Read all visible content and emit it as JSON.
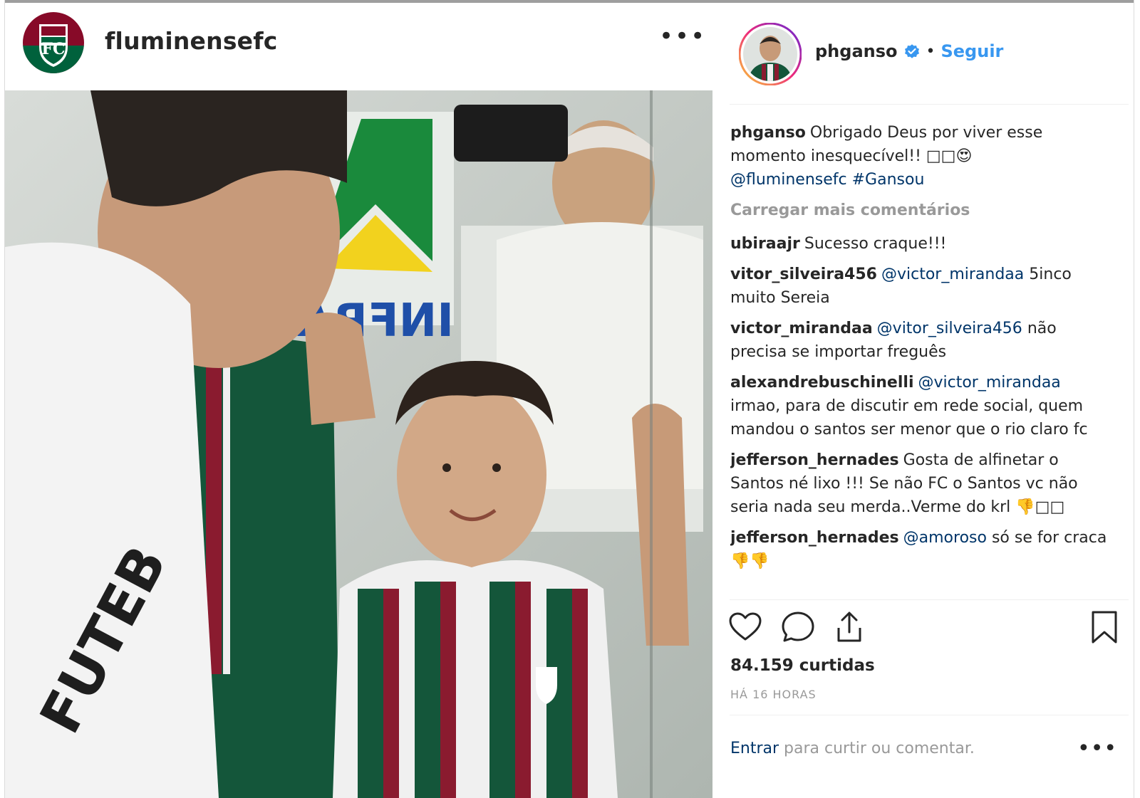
{
  "left_header": {
    "username": "fluminensefc",
    "more_label": "•••"
  },
  "post": {
    "author": "phganso",
    "follow_label": "Seguir",
    "separator": "•",
    "caption": {
      "user": "phganso",
      "text": "Obrigado Deus por viver esse momento inesquecível!! □□😍",
      "mention": "@fluminensefc",
      "hashtag": "#Gansou"
    },
    "load_more_label": "Carregar mais comentários",
    "comments": [
      {
        "user": "ubiraajr",
        "mention": "",
        "text": "Sucesso craque!!!"
      },
      {
        "user": "vitor_silveira456",
        "mention": "@victor_mirandaa",
        "text": "5inco muito Sereia"
      },
      {
        "user": "victor_mirandaa",
        "mention": "@vitor_silveira456",
        "text": "não precisa se importar freguês"
      },
      {
        "user": "alexandrebuschinelli",
        "mention": "@victor_mirandaa",
        "text": "irmao, para de discutir em rede social, quem mandou o santos ser menor que o rio claro fc"
      },
      {
        "user": "jefferson_hernades",
        "mention": "",
        "text": "Gosta de alfinetar o Santos né lixo !!! Se não FC o Santos vc não seria nada seu merda..Verme do krl 👎□□"
      },
      {
        "user": "jefferson_hernades",
        "mention": "@amoroso",
        "text": "só se for craca 👎👎"
      }
    ],
    "likes": "84.159 curtidas",
    "time": "HÁ 16 HORAS",
    "login_link": "Entrar",
    "login_text": "para curtir ou comentar.",
    "login_more": "•••"
  },
  "icons": {
    "like": "heart-icon",
    "comment": "comment-icon",
    "share": "share-icon",
    "save": "bookmark-icon",
    "verified": "verified-badge-icon"
  },
  "colors": {
    "link_blue": "#003569",
    "follow_blue": "#3897f0",
    "muted": "#999999",
    "text": "#262626",
    "flu_green": "#00613c",
    "flu_grenat": "#870a28"
  }
}
